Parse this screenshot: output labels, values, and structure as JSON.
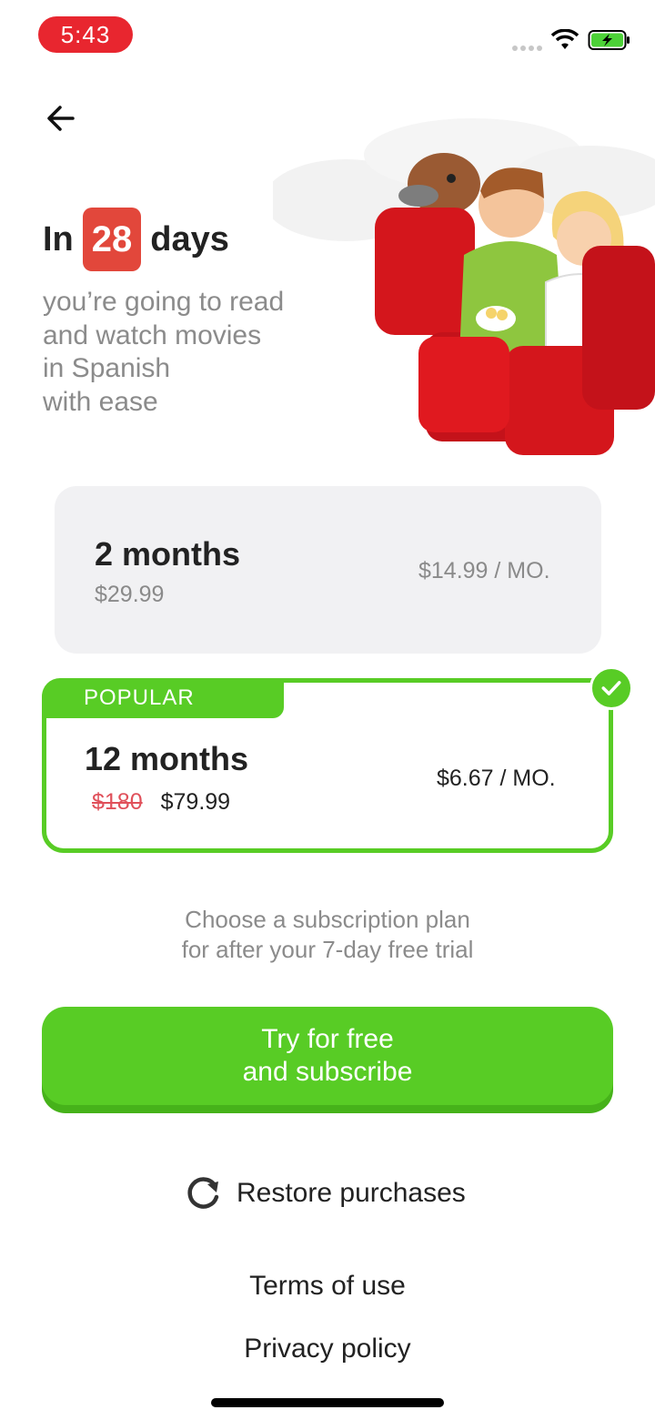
{
  "status_bar": {
    "time": "5:43"
  },
  "header": {
    "prefix": "In",
    "days": "28",
    "suffix": "days",
    "sub_lines": [
      "you’re going to read",
      "and watch movies",
      "in Spanish",
      "with ease"
    ]
  },
  "plans": [
    {
      "title": "2 months",
      "total": "$29.99",
      "monthly": "$14.99 / MO.",
      "selected": false
    },
    {
      "tag": "POPULAR",
      "title": "12 months",
      "old_price": "$180",
      "total": "$79.99",
      "monthly": "$6.67 / MO.",
      "selected": true
    }
  ],
  "trial_note": [
    "Choose a subscription plan",
    "for after your 7-day free trial"
  ],
  "cta": {
    "line1": "Try for free",
    "line2": "and subscribe"
  },
  "restore_label": "Restore purchases",
  "links": {
    "terms": "Terms of use",
    "privacy": "Privacy policy"
  },
  "colors": {
    "accent_green": "#58cc25",
    "badge_red": "#e2473b",
    "status_red": "#e8262f"
  },
  "icons": [
    "back-arrow-icon",
    "wifi-icon",
    "battery-icon",
    "check-icon",
    "restore-icon"
  ]
}
